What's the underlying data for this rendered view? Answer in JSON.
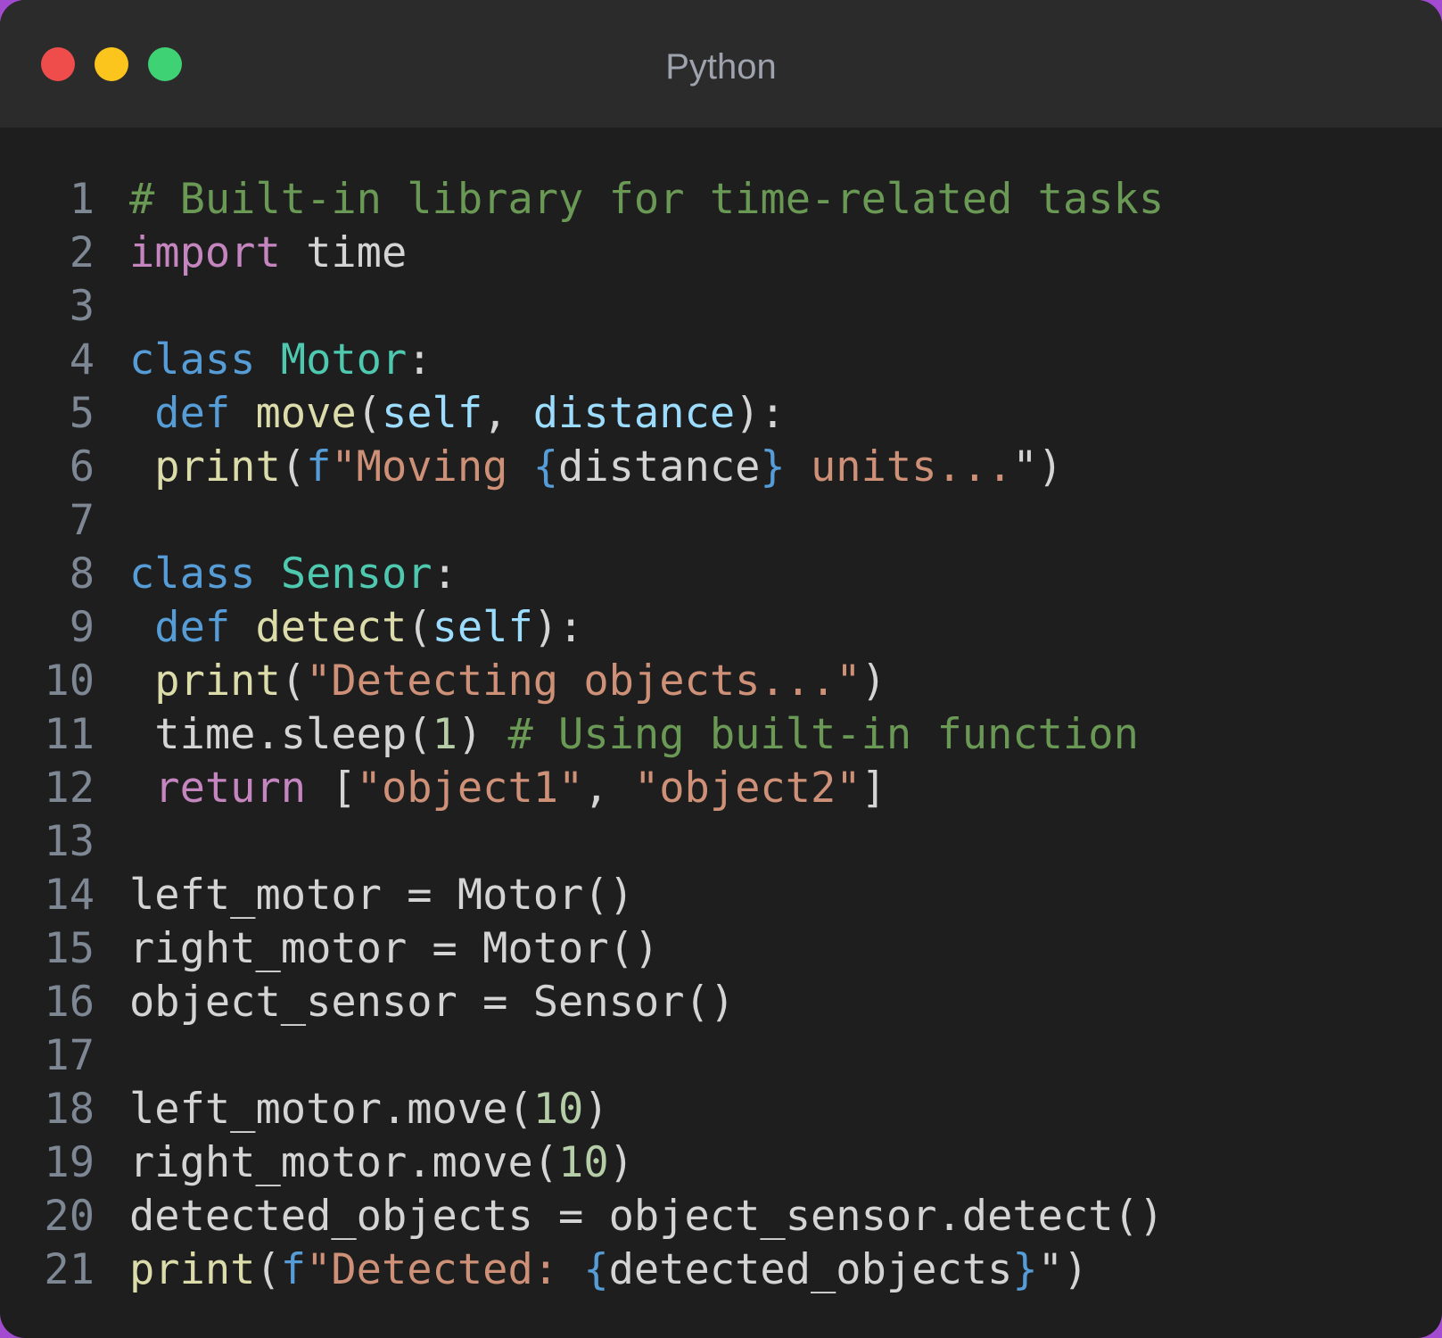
{
  "window": {
    "title": "Python",
    "buttons": [
      {
        "name": "close",
        "color": "#ee4d4c"
      },
      {
        "name": "minimize",
        "color": "#fcc51d"
      },
      {
        "name": "zoom",
        "color": "#3fd274"
      }
    ]
  },
  "colors": {
    "background": "#1e1e1e",
    "titlebar": "#2b2b2b",
    "line_number": "#7e8794",
    "default": "#d4d4d4",
    "comment": "#6a9955",
    "keyword_control": "#c586c0",
    "keyword": "#569cd6",
    "class_name": "#4ec9b0",
    "function": "#dcdcaa",
    "parameter": "#9cdcfe",
    "string": "#ce9178",
    "number": "#b5cea8"
  },
  "code": {
    "language": "Python",
    "lines": [
      {
        "number": "1",
        "tokens": [
          {
            "t": "# Built-in library for time-related tasks",
            "c": "comment"
          }
        ]
      },
      {
        "number": "2",
        "tokens": [
          {
            "t": "import",
            "c": "keyword_control"
          },
          {
            "t": " time",
            "c": "default"
          }
        ]
      },
      {
        "number": "3",
        "tokens": []
      },
      {
        "number": "4",
        "tokens": [
          {
            "t": "class",
            "c": "keyword"
          },
          {
            "t": " ",
            "c": "default"
          },
          {
            "t": "Motor",
            "c": "class_name"
          },
          {
            "t": ":",
            "c": "default"
          }
        ]
      },
      {
        "number": "5",
        "tokens": [
          {
            "t": " ",
            "c": "default"
          },
          {
            "t": "def",
            "c": "keyword"
          },
          {
            "t": " ",
            "c": "default"
          },
          {
            "t": "move",
            "c": "function"
          },
          {
            "t": "(",
            "c": "default"
          },
          {
            "t": "self",
            "c": "parameter"
          },
          {
            "t": ", ",
            "c": "default"
          },
          {
            "t": "distance",
            "c": "parameter"
          },
          {
            "t": "):",
            "c": "default"
          }
        ]
      },
      {
        "number": "6",
        "tokens": [
          {
            "t": " ",
            "c": "default"
          },
          {
            "t": "print",
            "c": "function"
          },
          {
            "t": "(",
            "c": "default"
          },
          {
            "t": "f",
            "c": "keyword"
          },
          {
            "t": "\"Moving ",
            "c": "string"
          },
          {
            "t": "{",
            "c": "keyword"
          },
          {
            "t": "distance",
            "c": "default"
          },
          {
            "t": "}",
            "c": "keyword"
          },
          {
            "t": " units...",
            "c": "string"
          },
          {
            "t": "\")",
            "c": "default"
          }
        ]
      },
      {
        "number": "7",
        "tokens": []
      },
      {
        "number": "8",
        "tokens": [
          {
            "t": "class",
            "c": "keyword"
          },
          {
            "t": " ",
            "c": "default"
          },
          {
            "t": "Sensor",
            "c": "class_name"
          },
          {
            "t": ":",
            "c": "default"
          }
        ]
      },
      {
        "number": "9",
        "tokens": [
          {
            "t": " ",
            "c": "default"
          },
          {
            "t": "def",
            "c": "keyword"
          },
          {
            "t": " ",
            "c": "default"
          },
          {
            "t": "detect",
            "c": "function"
          },
          {
            "t": "(",
            "c": "default"
          },
          {
            "t": "self",
            "c": "parameter"
          },
          {
            "t": "):",
            "c": "default"
          }
        ]
      },
      {
        "number": "10",
        "tokens": [
          {
            "t": " ",
            "c": "default"
          },
          {
            "t": "print",
            "c": "function"
          },
          {
            "t": "(",
            "c": "default"
          },
          {
            "t": "\"Detecting objects...\"",
            "c": "string"
          },
          {
            "t": ")",
            "c": "default"
          }
        ]
      },
      {
        "number": "11",
        "tokens": [
          {
            "t": " time.sleep(",
            "c": "default"
          },
          {
            "t": "1",
            "c": "number"
          },
          {
            "t": ") ",
            "c": "default"
          },
          {
            "t": "# Using built-in function",
            "c": "comment"
          }
        ]
      },
      {
        "number": "12",
        "tokens": [
          {
            "t": " ",
            "c": "default"
          },
          {
            "t": "return",
            "c": "keyword_control"
          },
          {
            "t": " [",
            "c": "default"
          },
          {
            "t": "\"object1\"",
            "c": "string"
          },
          {
            "t": ", ",
            "c": "default"
          },
          {
            "t": "\"object2\"",
            "c": "string"
          },
          {
            "t": "]",
            "c": "default"
          }
        ]
      },
      {
        "number": "13",
        "tokens": []
      },
      {
        "number": "14",
        "tokens": [
          {
            "t": "left_motor = Motor()",
            "c": "default"
          }
        ]
      },
      {
        "number": "15",
        "tokens": [
          {
            "t": "right_motor = Motor()",
            "c": "default"
          }
        ]
      },
      {
        "number": "16",
        "tokens": [
          {
            "t": "object_sensor = Sensor()",
            "c": "default"
          }
        ]
      },
      {
        "number": "17",
        "tokens": []
      },
      {
        "number": "18",
        "tokens": [
          {
            "t": "left_motor.move(",
            "c": "default"
          },
          {
            "t": "10",
            "c": "number"
          },
          {
            "t": ")",
            "c": "default"
          }
        ]
      },
      {
        "number": "19",
        "tokens": [
          {
            "t": "right_motor.move(",
            "c": "default"
          },
          {
            "t": "10",
            "c": "number"
          },
          {
            "t": ")",
            "c": "default"
          }
        ]
      },
      {
        "number": "20",
        "tokens": [
          {
            "t": "detected_objects = object_sensor.detect()",
            "c": "default"
          }
        ]
      },
      {
        "number": "21",
        "tokens": [
          {
            "t": "print",
            "c": "function"
          },
          {
            "t": "(",
            "c": "default"
          },
          {
            "t": "f",
            "c": "keyword"
          },
          {
            "t": "\"Detected: ",
            "c": "string"
          },
          {
            "t": "{",
            "c": "keyword"
          },
          {
            "t": "detected_objects",
            "c": "default"
          },
          {
            "t": "}",
            "c": "keyword"
          },
          {
            "t": "\")",
            "c": "default"
          }
        ]
      }
    ]
  }
}
